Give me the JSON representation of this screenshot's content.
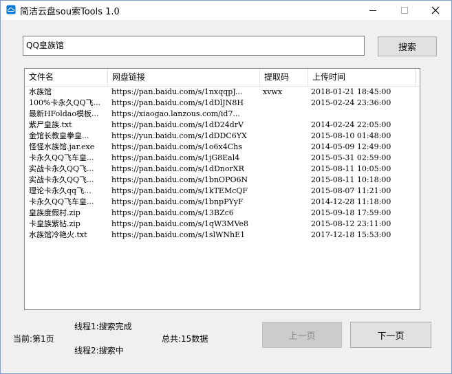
{
  "window": {
    "title": "简洁云盘sou索Tools 1.0"
  },
  "search": {
    "value": "QQ皇族馆",
    "button_label": "搜索"
  },
  "table": {
    "headers": [
      "文件名",
      "网盘链接",
      "提取码",
      "上传时间"
    ],
    "rows": [
      [
        "水族馆",
        "https://pan.baidu.com/s/1nxqqpJ...",
        "xvwx",
        "2018-01-21 18:45:00"
      ],
      [
        "100%卡永久QQ飞...",
        "https://pan.baidu.com/s/1dDlJN8H",
        "",
        "2015-02-24 23:36:00"
      ],
      [
        "最新HFoldao模板...",
        "https://xiaogao.lanzous.com/id7...",
        "",
        ""
      ],
      [
        "紫尸皇族.txt",
        "https://pan.baidu.com/s/1dD24drV",
        "",
        "2014-02-24 22:05:00"
      ],
      [
        "金馆长教皇拳皇...",
        "https://yun.baidu.com/s/1dDDC6YX",
        "",
        "2015-08-10 01:48:00"
      ],
      [
        "怪怪水族馆.jar.exe",
        "https://pan.baidu.com/s/1o6x4Chs",
        "",
        "2014-05-09 12:49:00"
      ],
      [
        "卡永久QQ飞车皇...",
        "https://pan.baidu.com/s/1jG8Eal4",
        "",
        "2015-05-31 02:59:00"
      ],
      [
        "实战卡永久QQ飞...",
        "https://pan.baidu.com/s/1dDnorXR",
        "",
        "2015-08-11 10:05:00"
      ],
      [
        "实战卡永久QQ飞...",
        "https://pan.baidu.com/s/1bnOPO6N",
        "",
        "2015-08-11 10:18:00"
      ],
      [
        "理论卡永久qq飞...",
        "https://pan.baidu.com/s/1kTEMcQF",
        "",
        "2015-08-07 11:21:00"
      ],
      [
        "卡永久QQ飞车皇...",
        "https://pan.baidu.com/s/1bnpPYyF",
        "",
        "2014-12-28 11:18:00"
      ],
      [
        "皇族度假村.zip",
        "https://pan.baidu.com/s/13BZc6",
        "",
        "2015-09-18 17:59:00"
      ],
      [
        "卡皇族紫钻.zip",
        "https://pan.baidu.com/s/1qW3MVe8",
        "",
        "2015-08-12 23:11:00"
      ],
      [
        "水族馆冷艳火.txt",
        "https://pan.baidu.com/s/1slWNhE1",
        "",
        "2017-12-18 15:53:00"
      ]
    ]
  },
  "status": {
    "current_page": "当前:第1页",
    "thread1": "线程1:搜索完成",
    "thread2": "线程2:搜索中",
    "total": "总共:15数据"
  },
  "pager": {
    "prev_label": "上一页",
    "next_label": "下一页"
  },
  "colors": {
    "accent": "#0078d7",
    "window_bg": "#f0f0f0",
    "disabled_button": "#cccccc"
  }
}
